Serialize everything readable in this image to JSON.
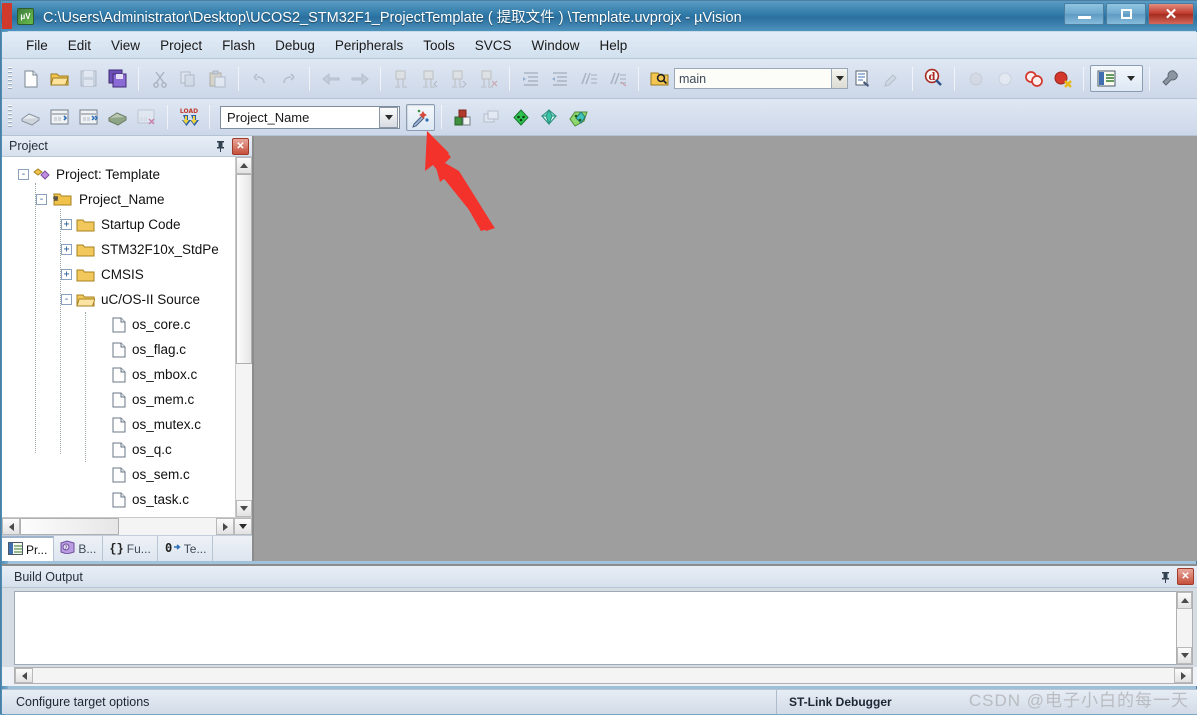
{
  "window": {
    "title": "C:\\Users\\Administrator\\Desktop\\UCOS2_STM32F1_ProjectTemplate ( 提取文件 ) \\Template.uvprojx - µVision",
    "app_icon": "uvision-icon",
    "minimize_label": "Minimize",
    "maximize_label": "Maximize",
    "close_label": "✕"
  },
  "menu": {
    "items": [
      {
        "label": "File"
      },
      {
        "label": "Edit"
      },
      {
        "label": "View"
      },
      {
        "label": "Project"
      },
      {
        "label": "Flash"
      },
      {
        "label": "Debug"
      },
      {
        "label": "Peripherals"
      },
      {
        "label": "Tools"
      },
      {
        "label": "SVCS"
      },
      {
        "label": "Window"
      },
      {
        "label": "Help"
      }
    ]
  },
  "toolbar_main": {
    "search_value": "main",
    "search_placeholder": "",
    "buttons": [
      {
        "name": "new-file-button",
        "tip": "New"
      },
      {
        "name": "open-file-button",
        "tip": "Open"
      },
      {
        "name": "save-button",
        "tip": "Save"
      },
      {
        "name": "save-all-button",
        "tip": "Save All"
      },
      {
        "name": "cut-button",
        "tip": "Cut"
      },
      {
        "name": "copy-button",
        "tip": "Copy"
      },
      {
        "name": "paste-button",
        "tip": "Paste"
      },
      {
        "name": "undo-button",
        "tip": "Undo"
      },
      {
        "name": "redo-button",
        "tip": "Redo"
      },
      {
        "name": "navigate-back-button",
        "tip": "Back"
      },
      {
        "name": "navigate-forward-button",
        "tip": "Forward"
      },
      {
        "name": "bookmark-toggle-button",
        "tip": "Toggle Bookmark"
      },
      {
        "name": "bookmark-prev-button",
        "tip": "Previous Bookmark"
      },
      {
        "name": "bookmark-next-button",
        "tip": "Next Bookmark"
      },
      {
        "name": "bookmark-clear-button",
        "tip": "Clear Bookmarks"
      },
      {
        "name": "indent-button",
        "tip": "Indent"
      },
      {
        "name": "outdent-button",
        "tip": "Outdent"
      },
      {
        "name": "comment-button",
        "tip": "Comment"
      },
      {
        "name": "uncomment-button",
        "tip": "Uncomment"
      },
      {
        "name": "find-in-files-button",
        "tip": "Find in Files"
      },
      {
        "name": "find-combo-go-button",
        "tip": "Find"
      },
      {
        "name": "insert-file-button",
        "tip": "Insert File"
      },
      {
        "name": "configure-button",
        "tip": "Configure"
      },
      {
        "name": "debug-start-button",
        "tip": "Start Debug"
      },
      {
        "name": "breakpoint-insert-button",
        "tip": "Insert Breakpoint"
      },
      {
        "name": "breakpoint-disable-button",
        "tip": "Disable Breakpoint"
      },
      {
        "name": "breakpoint-disable-all-button",
        "tip": "Disable All Breakpoints"
      },
      {
        "name": "breakpoint-kill-all-button",
        "tip": "Kill All Breakpoints"
      },
      {
        "name": "window-manager-button",
        "tip": "Window Manager"
      },
      {
        "name": "configure-options-button",
        "tip": "Configure"
      }
    ]
  },
  "toolbar_build": {
    "project_combo_value": "Project_Name",
    "buttons": [
      {
        "name": "translate-button",
        "tip": "Translate Current File"
      },
      {
        "name": "build-target-button",
        "tip": "Build"
      },
      {
        "name": "rebuild-all-button",
        "tip": "Rebuild All"
      },
      {
        "name": "batch-build-button",
        "tip": "Batch Build"
      },
      {
        "name": "stop-build-button",
        "tip": "Stop Build"
      },
      {
        "name": "download-button",
        "tip": "Download"
      },
      {
        "name": "target-options-button",
        "tip": "Options for Target"
      },
      {
        "name": "manage-project-items-button",
        "tip": "Manage Project Items"
      },
      {
        "name": "multi-project-button",
        "tip": "Multi-Project"
      },
      {
        "name": "pack-installer-button",
        "tip": "Pack Installer"
      },
      {
        "name": "manage-run-time-button",
        "tip": "Manage Run-Time Environment"
      },
      {
        "name": "select-software-packs-button",
        "tip": "Select Software Packs"
      }
    ]
  },
  "project_panel": {
    "title": "Project",
    "pin_label": "⊥",
    "close_label": "✕",
    "tree": [
      {
        "depth": 0,
        "expander": "-",
        "icon": "project-icon",
        "label": "Project: Template"
      },
      {
        "depth": 1,
        "expander": "-",
        "icon": "target-icon",
        "label": "Project_Name"
      },
      {
        "depth": 2,
        "expander": "+",
        "icon": "folder-icon",
        "label": "Startup Code"
      },
      {
        "depth": 2,
        "expander": "+",
        "icon": "folder-icon",
        "label": "STM32F10x_StdPe"
      },
      {
        "depth": 2,
        "expander": "+",
        "icon": "folder-icon",
        "label": "CMSIS"
      },
      {
        "depth": 2,
        "expander": "-",
        "icon": "folder-open-icon",
        "label": "uC/OS-II Source"
      },
      {
        "depth": 3,
        "expander": "",
        "icon": "c-file-icon",
        "label": "os_core.c"
      },
      {
        "depth": 3,
        "expander": "",
        "icon": "c-file-icon",
        "label": "os_flag.c"
      },
      {
        "depth": 3,
        "expander": "",
        "icon": "c-file-icon",
        "label": "os_mbox.c"
      },
      {
        "depth": 3,
        "expander": "",
        "icon": "c-file-icon",
        "label": "os_mem.c"
      },
      {
        "depth": 3,
        "expander": "",
        "icon": "c-file-icon",
        "label": "os_mutex.c"
      },
      {
        "depth": 3,
        "expander": "",
        "icon": "c-file-icon",
        "label": "os_q.c"
      },
      {
        "depth": 3,
        "expander": "",
        "icon": "c-file-icon",
        "label": "os_sem.c"
      },
      {
        "depth": 3,
        "expander": "",
        "icon": "c-file-icon",
        "label": "os_task.c"
      }
    ],
    "tabs": [
      {
        "icon": "project-tab-icon",
        "label": "Pr...",
        "active": true
      },
      {
        "icon": "books-tab-icon",
        "label": "B...",
        "active": false
      },
      {
        "icon": "functions-tab-icon",
        "label": "Fu...",
        "active": false
      },
      {
        "icon": "templates-tab-icon",
        "label": "Te...",
        "active": false
      }
    ],
    "tab_icon_glyphs": {
      "functions-tab-icon": "{}",
      "templates-tab-icon": "0"
    }
  },
  "build_output": {
    "title": "Build Output",
    "pin_label": "⊥",
    "close_label": "✕",
    "content": ""
  },
  "status_bar": {
    "message": "Configure target options",
    "debugger": "ST-Link Debugger",
    "watermark": "CSDN @电子小白的每一天"
  },
  "annotation": {
    "arrow_color": "#f4322c",
    "points_to": "target-options-button"
  },
  "colors": {
    "title_bar": "#2f7aa8",
    "accent_red": "#c0392b",
    "workspace_gray": "#9e9e9e",
    "panel_bg": "#f0f0f0"
  }
}
